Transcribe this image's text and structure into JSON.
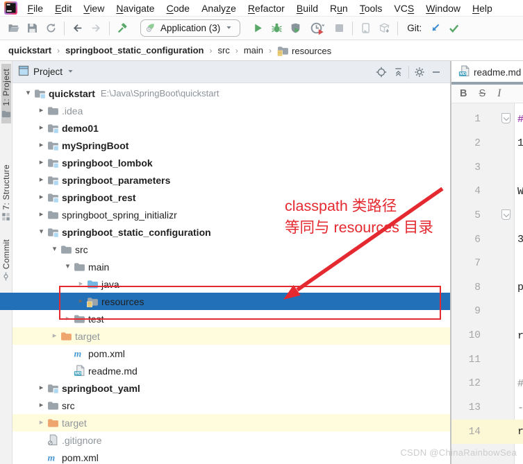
{
  "colors": {
    "selection_blue": "#2270b8",
    "excluded_row_yellow": "#fffbdd",
    "annotation_red": "#e42a30",
    "run_green": "#59a869",
    "folder_gray": "#9ba3ab",
    "java_folder_blue": "#74b6e2",
    "target_folder_orange": "#efa56e",
    "maven_blue": "#4d9bd3",
    "markdown_teal": "#3f9fbe"
  },
  "menu": {
    "items": [
      {
        "label": "File",
        "mnemonic": 0
      },
      {
        "label": "Edit",
        "mnemonic": 0
      },
      {
        "label": "View",
        "mnemonic": 0
      },
      {
        "label": "Navigate",
        "mnemonic": 0
      },
      {
        "label": "Code",
        "mnemonic": 0
      },
      {
        "label": "Analyze",
        "mnemonic": 5
      },
      {
        "label": "Refactor",
        "mnemonic": 0
      },
      {
        "label": "Build",
        "mnemonic": 0
      },
      {
        "label": "Run",
        "mnemonic": 1
      },
      {
        "label": "Tools",
        "mnemonic": 0
      },
      {
        "label": "VCS",
        "mnemonic": 2
      },
      {
        "label": "Window",
        "mnemonic": 0
      },
      {
        "label": "Help",
        "mnemonic": 0
      }
    ]
  },
  "toolbar": {
    "run_config_label": "Application (3)",
    "git_label": "Git:"
  },
  "breadcrumbs": [
    {
      "label": "quickstart",
      "bold": true
    },
    {
      "label": "springboot_static_configuration",
      "bold": true
    },
    {
      "label": "src"
    },
    {
      "label": "main"
    },
    {
      "label": "resources",
      "icon": "resources-folder"
    }
  ],
  "tool_window_bar": [
    {
      "label": "1: Project",
      "icon": "project-tool",
      "active": true
    },
    {
      "label": "7: Structure",
      "icon": "structure-tool",
      "active": false
    },
    {
      "label": "Commit",
      "icon": "commit-tool",
      "active": false
    }
  ],
  "project_panel": {
    "title": "Project"
  },
  "tree": [
    {
      "label": "quickstart",
      "path_suffix": "E:\\Java\\SpringBoot\\quickstart",
      "level": 0,
      "arrow": "down",
      "icon": "module-folder",
      "bold": true
    },
    {
      "label": ".idea",
      "level": 1,
      "arrow": "right",
      "icon": "folder",
      "dim": true
    },
    {
      "label": "demo01",
      "level": 1,
      "arrow": "right",
      "icon": "module-folder",
      "bold": true
    },
    {
      "label": "mySpringBoot",
      "level": 1,
      "arrow": "right",
      "icon": "module-folder",
      "bold": true
    },
    {
      "label": "springboot_lombok",
      "level": 1,
      "arrow": "right",
      "icon": "module-folder",
      "bold": true
    },
    {
      "label": "springboot_parameters",
      "level": 1,
      "arrow": "right",
      "icon": "module-folder",
      "bold": true
    },
    {
      "label": "springboot_rest",
      "level": 1,
      "arrow": "right",
      "icon": "module-folder",
      "bold": true
    },
    {
      "label": "springboot_spring_initializr",
      "level": 1,
      "arrow": "right",
      "icon": "folder"
    },
    {
      "label": "springboot_static_configuration",
      "level": 1,
      "arrow": "down",
      "icon": "module-folder",
      "bold": true
    },
    {
      "label": "src",
      "level": 2,
      "arrow": "down",
      "icon": "folder"
    },
    {
      "label": "main",
      "level": 3,
      "arrow": "down",
      "icon": "folder"
    },
    {
      "label": "java",
      "level": 4,
      "arrow": "right-dim",
      "icon": "java-folder"
    },
    {
      "label": "resources",
      "level": 4,
      "arrow": "right",
      "icon": "resources-folder",
      "selected": true
    },
    {
      "label": "test",
      "level": 3,
      "arrow": "right-dim",
      "icon": "folder"
    },
    {
      "label": "target",
      "level": 2,
      "arrow": "right-dim",
      "icon": "target-folder",
      "rowbg": "yellow",
      "dim": true
    },
    {
      "label": "pom.xml",
      "level": 3,
      "icon": "maven-file"
    },
    {
      "label": "readme.md",
      "level": 3,
      "icon": "markdown-file"
    },
    {
      "label": "springboot_yaml",
      "level": 1,
      "arrow": "right",
      "icon": "module-folder",
      "bold": true
    },
    {
      "label": "src",
      "level": 1,
      "arrow": "right",
      "icon": "folder"
    },
    {
      "label": "target",
      "level": 1,
      "arrow": "right-dim",
      "icon": "target-folder",
      "rowbg": "yellow",
      "dim": true
    },
    {
      "label": ".gitignore",
      "level": 1,
      "icon": "gitignore-file",
      "dim": true
    },
    {
      "label": "pom.xml",
      "level": 1,
      "icon": "maven-file"
    }
  ],
  "editor": {
    "tab_label": "readme.md",
    "format_toolbar": {
      "bold": "B",
      "strikethrough": "S",
      "italic": "I"
    },
    "lines": [
      {
        "n": "1",
        "frag": "#",
        "frag_color": "#871094",
        "fold": true
      },
      {
        "n": "2",
        "frag": "1"
      },
      {
        "n": "3"
      },
      {
        "n": "4",
        "frag": "W"
      },
      {
        "n": "5",
        "fold": true
      },
      {
        "n": "6",
        "frag": "3"
      },
      {
        "n": "7"
      },
      {
        "n": "8",
        "frag": "p"
      },
      {
        "n": "9"
      },
      {
        "n": "10",
        "frag": "r"
      },
      {
        "n": "11"
      },
      {
        "n": "12",
        "frag": "#",
        "frag_color": "#8a8a8a"
      },
      {
        "n": "13",
        "frag": "-",
        "frag_color": "#8a8a8a"
      },
      {
        "n": "14",
        "frag": "r",
        "highlight": true
      }
    ]
  },
  "annotation": {
    "text_line1": "classpath 类路径",
    "text_line2": "等同与 resources 目录"
  },
  "watermark": "CSDN @ChinaRainbowSea"
}
